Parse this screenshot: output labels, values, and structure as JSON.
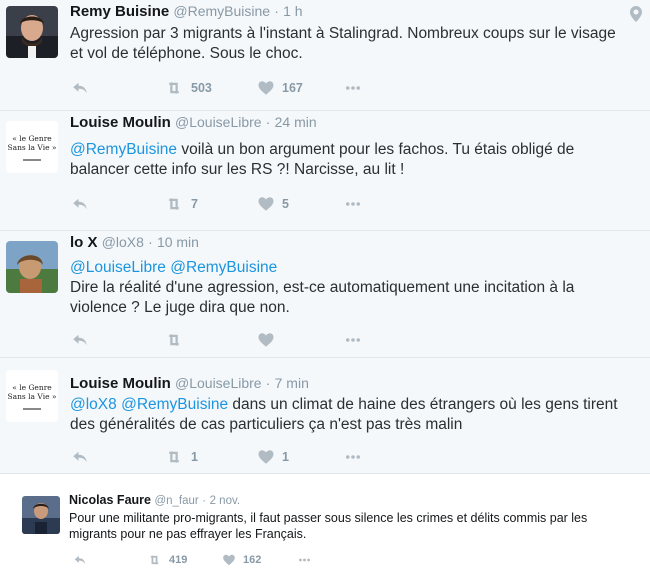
{
  "tweets": [
    {
      "name": "Remy Buisine",
      "handle": "@RemyBuisine",
      "time": "1 h",
      "text": "Agression par 3 migrants à l'instant à Stalingrad. Nombreux coups sur le visage et vol de téléphone. Sous le choc.",
      "retweets": "503",
      "likes": "167"
    },
    {
      "name": "Louise Moulin",
      "handle": "@LouiseLibre",
      "time": "24 min",
      "mention": "@RemyBuisine",
      "text": " voilà un bon argument pour les fachos. Tu étais obligé de balancer cette info sur les RS ?! Narcisse, au lit !",
      "retweets": "7",
      "likes": "5",
      "avatar_text": "« le Genre Sans la Vie »"
    },
    {
      "name": "lo X",
      "handle": "@loX8",
      "time": "10 min",
      "mention1": "@LouiseLibre",
      "mention2": "@RemyBuisine",
      "text": "Dire la réalité d'une agression, est-ce automatiquement une incitation à la violence ? Le juge dira que non."
    },
    {
      "name": "Louise Moulin",
      "handle": "@LouiseLibre",
      "time": "7 min",
      "mention1": "@loX8",
      "mention2": "@RemyBuisine",
      "text": " dans un climat de haine des étrangers où les gens tirent des généralités de cas particuliers ça n'est pas très malin",
      "retweets": "1",
      "likes": "1"
    },
    {
      "name": "Nicolas Faure",
      "handle": "@n_faur",
      "time": "2 nov.",
      "text": "Pour une militante pro-migrants, il faut passer sous silence les crimes et délits commis par les migrants pour ne pas effrayer les Français.",
      "retweets": "419",
      "likes": "162"
    }
  ],
  "separator": "·",
  "colors": {
    "link": "#1b95e0",
    "muted": "#8899a6",
    "bg": "#f5f8fa"
  },
  "icons": [
    "reply-icon",
    "retweet-icon",
    "heart-icon",
    "more-icon",
    "location-icon"
  ]
}
